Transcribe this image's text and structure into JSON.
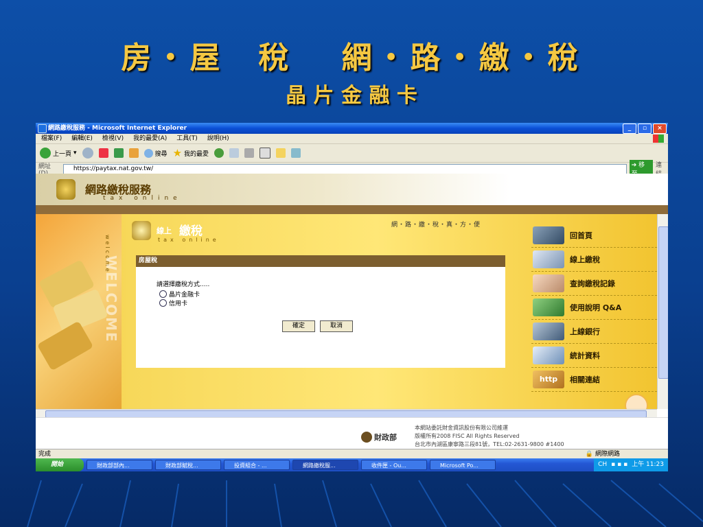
{
  "slide": {
    "title": "房・屋　稅　 網・路・繳・稅",
    "subtitle": "晶 片 金 融 卡"
  },
  "window": {
    "title": "網路繳稅服務 - Microsoft Internet Explorer"
  },
  "menu": [
    "檔案(F)",
    "編輯(E)",
    "檢視(V)",
    "我的最愛(A)",
    "工具(T)",
    "說明(H)"
  ],
  "toolbar": {
    "back": "上一頁",
    "search": "搜尋",
    "favorites": "我的最愛"
  },
  "address": {
    "label": "網址(D)",
    "url": "https://paytax.nat.gov.tw/",
    "go": "移至",
    "links": "連結"
  },
  "site": {
    "logo_title": "網路繳稅服務",
    "logo_sub": "tax online",
    "online_small": "線上",
    "online_big": "繳稅",
    "online_sub": "tax online",
    "welcome_small": "welcome",
    "welcome_big": "WELCOME",
    "slogan": "網・路・繳・稅・真・方・便",
    "panel_title": "房屋稅",
    "prompt": "請選擇繳稅方式.....",
    "option_chip": "晶片金融卡",
    "option_credit": "信用卡",
    "confirm": "確定",
    "cancel": "取消"
  },
  "nav": [
    "回首頁",
    "線上繳稅",
    "查詢繳稅記錄",
    "使用說明 Q&A",
    "上線銀行",
    "統計資料",
    "相關連結"
  ],
  "footer": {
    "ministry": "財政部",
    "line1": "本網站委託財金資訊股份有限公司維運",
    "line2": "版權所有2008 FISC All Rights Reserved",
    "line3": "台北市內湖區康寧路三段81號，TEL:02-2631-9800 #1400"
  },
  "status": {
    "text": "完成",
    "zone": "網際網路"
  },
  "taskbar": {
    "start": "開始",
    "tasks": [
      "財政部部內...",
      "財政部賦稅...",
      "投資組合 - ...",
      "網路繳稅服...",
      "收件匣 - Ou...",
      "Microsoft Po..."
    ],
    "lang": "CH",
    "clock": "上午 11:23"
  },
  "colors": {
    "slide_bg": "#0d4fa8",
    "title": "#f5c842",
    "panel_head": "#7c5e2f"
  }
}
